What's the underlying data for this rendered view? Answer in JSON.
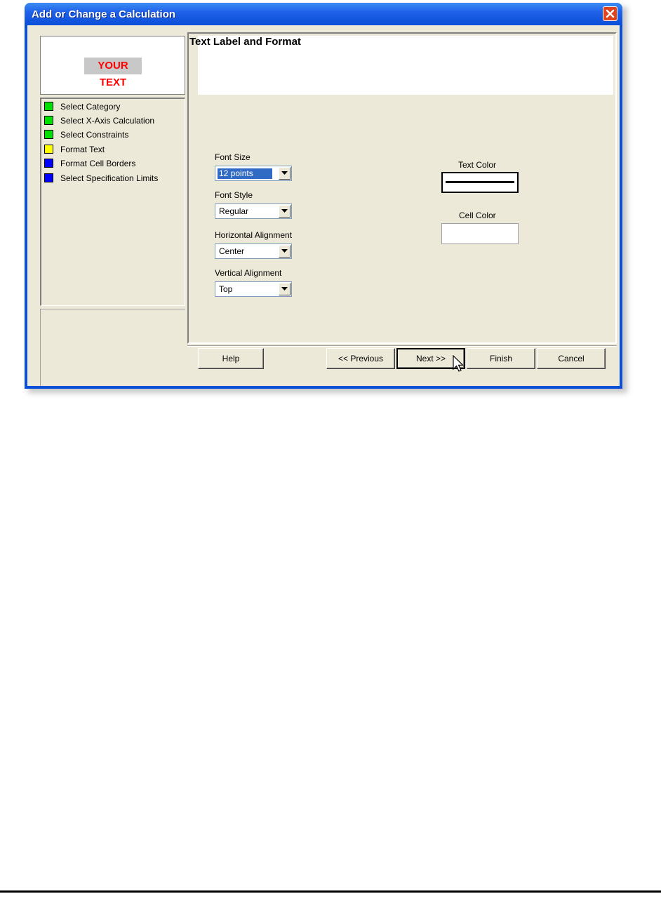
{
  "window": {
    "title": "Add or Change a Calculation"
  },
  "preview": {
    "sample_text": "YOUR TEXT"
  },
  "steps": [
    {
      "label": "Select Category",
      "color": "#00e000"
    },
    {
      "label": "Select X-Axis Calculation",
      "color": "#00e000"
    },
    {
      "label": "Select Constraints",
      "color": "#00e000"
    },
    {
      "label": "Format Text",
      "color": "#ffff00"
    },
    {
      "label": "Format Cell Borders",
      "color": "#0000ff"
    },
    {
      "label": "Select Specification Limits",
      "color": "#0000ff"
    }
  ],
  "section": {
    "title": "Text Label and Format"
  },
  "fields": {
    "font_size": {
      "label": "Font Size",
      "value": "12 points"
    },
    "font_style": {
      "label": "Font Style",
      "value": "Regular"
    },
    "horizontal_alignment": {
      "label": "Horizontal Alignment",
      "value": "Center"
    },
    "vertical_alignment": {
      "label": "Vertical Alignment",
      "value": "Top"
    }
  },
  "colors": {
    "text_color_label": "Text Color",
    "cell_color_label": "Cell Color"
  },
  "buttons": {
    "help": "Help",
    "previous": "<< Previous",
    "next": "Next >>",
    "finish": "Finish",
    "cancel": "Cancel"
  }
}
